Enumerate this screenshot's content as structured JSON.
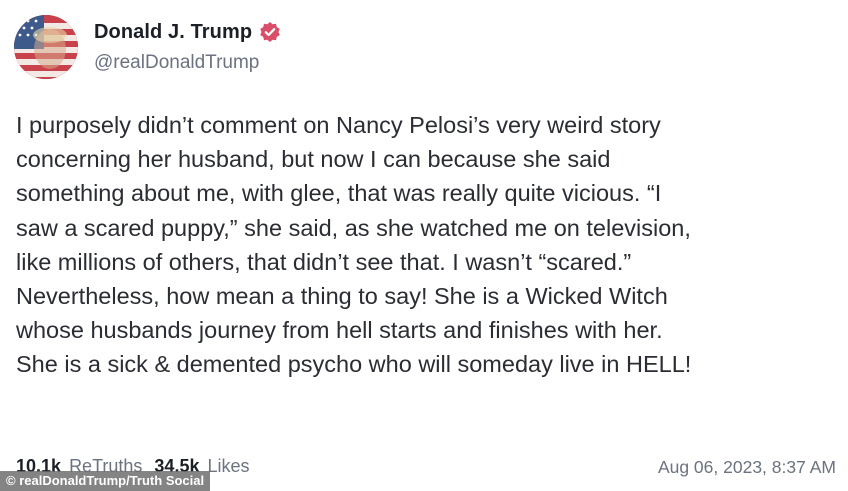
{
  "author": {
    "display_name": "Donald J. Trump",
    "handle": "@realDonaldTrump",
    "avatar_icon": "american-flag-portrait",
    "verified_icon": "verified-badge-icon",
    "verified_color": "#d94f6a"
  },
  "post": {
    "text": "I purposely didn’t comment on Nancy Pelosi’s very weird story\nconcerning her husband, but now I can because she said\nsomething about me, with glee, that was really quite vicious. “I\nsaw a scared puppy,” she said, as she watched me on television,\nlike millions of others,  that didn’t see that. I wasn’t “scared.”\nNevertheless, how mean a thing to say! She is a Wicked Witch\nwhose husbands journey from hell starts and finishes with her.\nShe is a sick & demented psycho who will someday live in HELL!"
  },
  "stats": {
    "retruths_count": "10.1k",
    "retruths_label": "ReTruths",
    "likes_count": "34.5k",
    "likes_label": "Likes"
  },
  "timestamp": "Aug 06, 2023, 8:37 AM",
  "watermark": "© realDonaldTrump/Truth Social"
}
